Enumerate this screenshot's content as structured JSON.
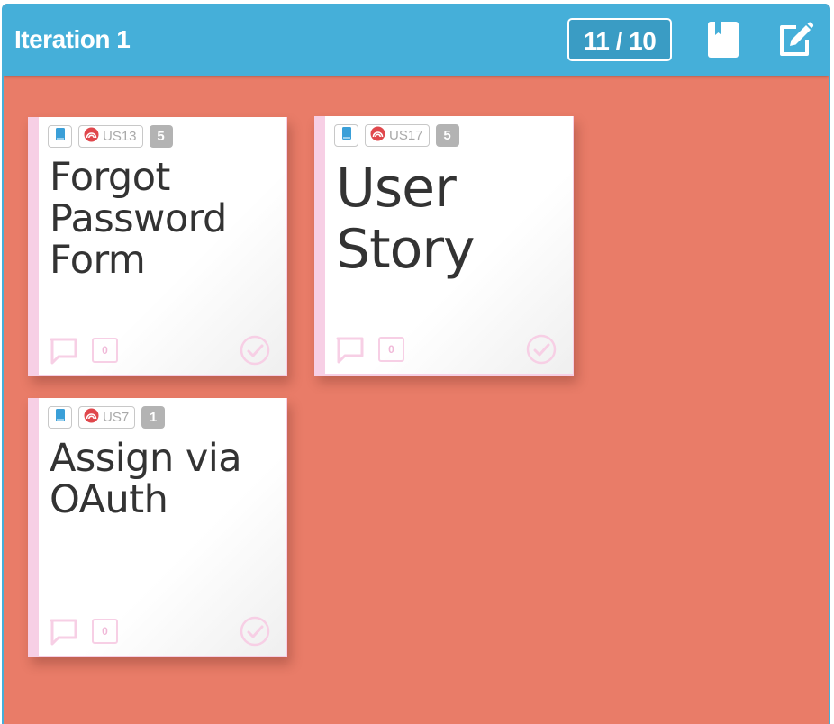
{
  "header": {
    "title": "Iteration 1",
    "points_counter": "11 / 10",
    "icons": [
      "book-icon",
      "edit-icon"
    ]
  },
  "colors": {
    "header_bg": "#45afd9",
    "lane_bg": "#e97c68",
    "card_stripe": "#f7cfe5",
    "story_icon": "#3a9fd8",
    "status_icon": "#e0474c",
    "points_badge": "#b3b3b3"
  },
  "cards": [
    {
      "type_icon": "book-icon",
      "status_icon": "signal-icon",
      "id": "US13",
      "points": "5",
      "title": "Forgot Password Form",
      "title_lines": [
        "Forgot",
        "Password",
        "Form"
      ],
      "tasks_count": "0"
    },
    {
      "type_icon": "book-icon",
      "status_icon": "signal-icon",
      "id": "US17",
      "points": "5",
      "title": "User Story",
      "title_lines": [
        "User",
        "Story"
      ],
      "tasks_count": "0"
    },
    {
      "type_icon": "book-icon",
      "status_icon": "signal-icon",
      "id": "US7",
      "points": "1",
      "title": "Assign via OAuth",
      "title_lines": [
        "Assign via",
        "OAuth"
      ],
      "tasks_count": "0"
    }
  ]
}
